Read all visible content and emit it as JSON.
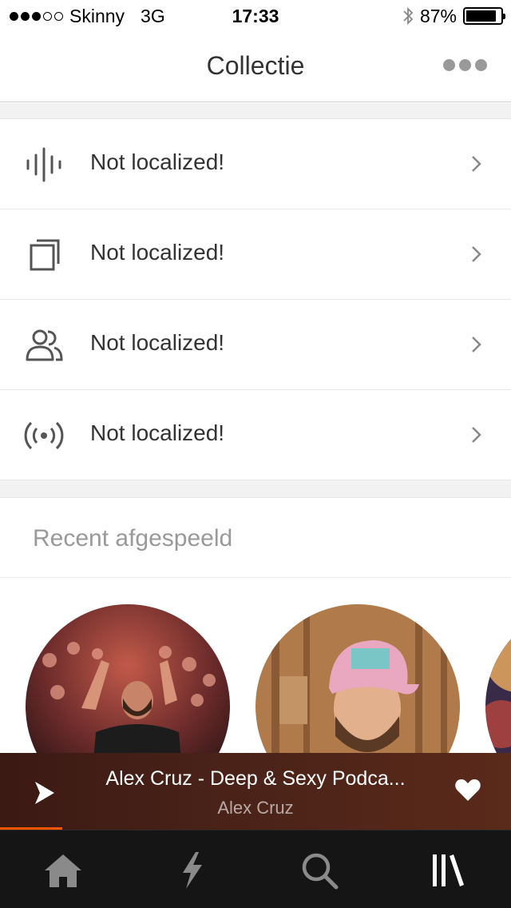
{
  "status_bar": {
    "carrier": "Skinny",
    "network": "3G",
    "time": "17:33",
    "battery": "87%",
    "battery_level": 0.87,
    "signal_bars": 3,
    "signal_total": 5
  },
  "navbar": {
    "title": "Collectie",
    "more_icon": "more-dots-icon"
  },
  "collection_items": [
    {
      "icon": "waveform-icon",
      "label": "Not localized!"
    },
    {
      "icon": "playlist-stack-icon",
      "label": "Not localized!"
    },
    {
      "icon": "users-icon",
      "label": "Not localized!"
    },
    {
      "icon": "broadcast-icon",
      "label": "Not localized!"
    }
  ],
  "recent": {
    "title": "Recent afgespeeld"
  },
  "player": {
    "track_title": "Alex Cruz - Deep & Sexy Podca...",
    "artist": "Alex Cruz",
    "progress": 0.12,
    "accent": "#ff5500"
  },
  "tabs": [
    {
      "name": "home",
      "icon": "home-icon"
    },
    {
      "name": "stream",
      "icon": "lightning-icon"
    },
    {
      "name": "search",
      "icon": "search-icon"
    },
    {
      "name": "collection",
      "icon": "library-icon"
    }
  ],
  "colors": {
    "brand_orange": "#ff5500",
    "tabbar_bg": "#151515",
    "player_bg": "#4a2218"
  }
}
